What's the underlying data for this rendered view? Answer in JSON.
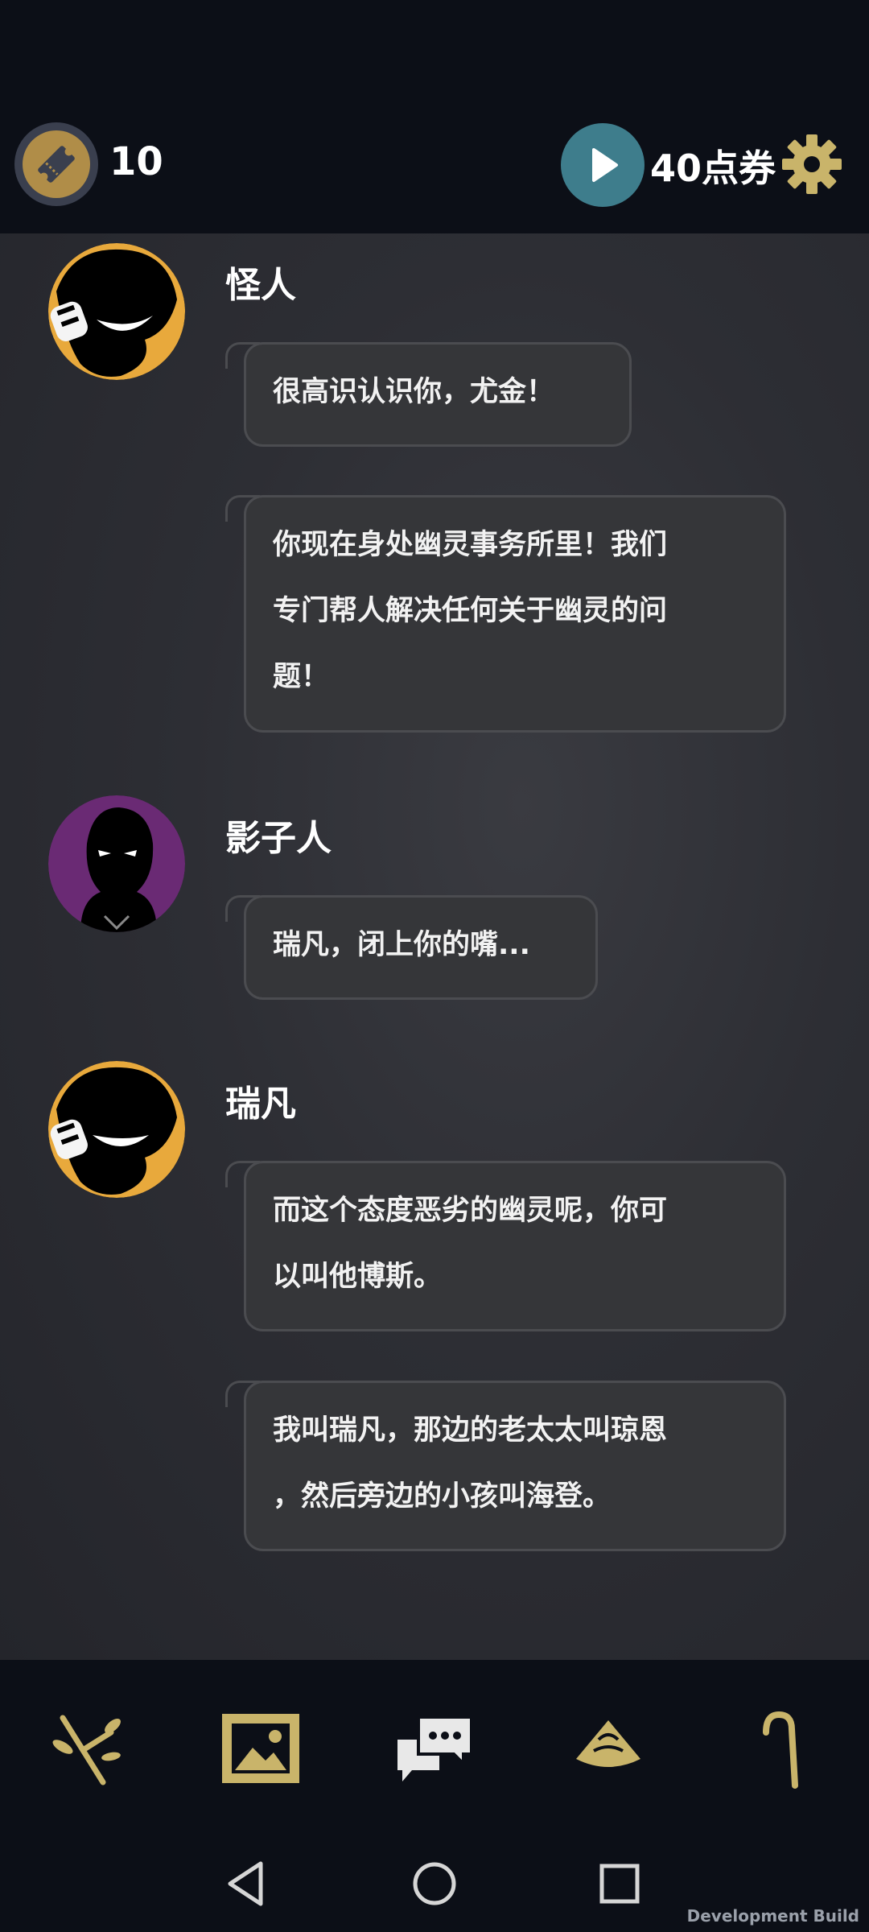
{
  "header": {
    "ticket_count": "10",
    "points_label": "40点券"
  },
  "messages": [
    {
      "sender": "怪人",
      "avatar_icon": "grinning-character-avatar-icon",
      "bubbles": [
        "很高识认识你，尤金！",
        "你现在身处幽灵事务所里！我们专门帮人解决任何关于幽灵的问题！"
      ]
    },
    {
      "sender": "影子人",
      "avatar_icon": "shadow-man-avatar-icon",
      "bubbles": [
        "瑞凡，闭上你的嘴..."
      ]
    },
    {
      "sender": "瑞凡",
      "avatar_icon": "smiling-character-avatar-icon",
      "bubbles": [
        "而这个态度恶劣的幽灵呢，你可以叫他博斯。",
        "我叫瑞凡，那边的老太太叫琼恩，然后旁边的小孩叫海登。"
      ]
    }
  ],
  "bubble_lines": {
    "m0b1": [
      "你现在身处幽灵事务所里！我们",
      "专门帮人解决任何关于幽灵的问",
      "题！"
    ],
    "m2b0": [
      "而这个态度恶劣的幽灵呢，你可",
      "以叫他博斯。"
    ],
    "m2b1": [
      "我叫瑞凡，那边的老太太叫琼恩",
      "，然后旁边的小孩叫海登。"
    ]
  },
  "bottom_nav": [
    "branch-icon",
    "gallery-icon",
    "chat-icon",
    "hat-icon",
    "cane-icon"
  ],
  "system_nav": [
    "back-icon",
    "home-icon",
    "recents-icon"
  ],
  "footer": {
    "dev_label": "Development Build"
  },
  "colors": {
    "background": "#0c0f17",
    "accent_gold": "#b08d48",
    "play_teal": "#3e7d8c",
    "bubble": "#353639",
    "icon_olive": "#c9b46a"
  }
}
